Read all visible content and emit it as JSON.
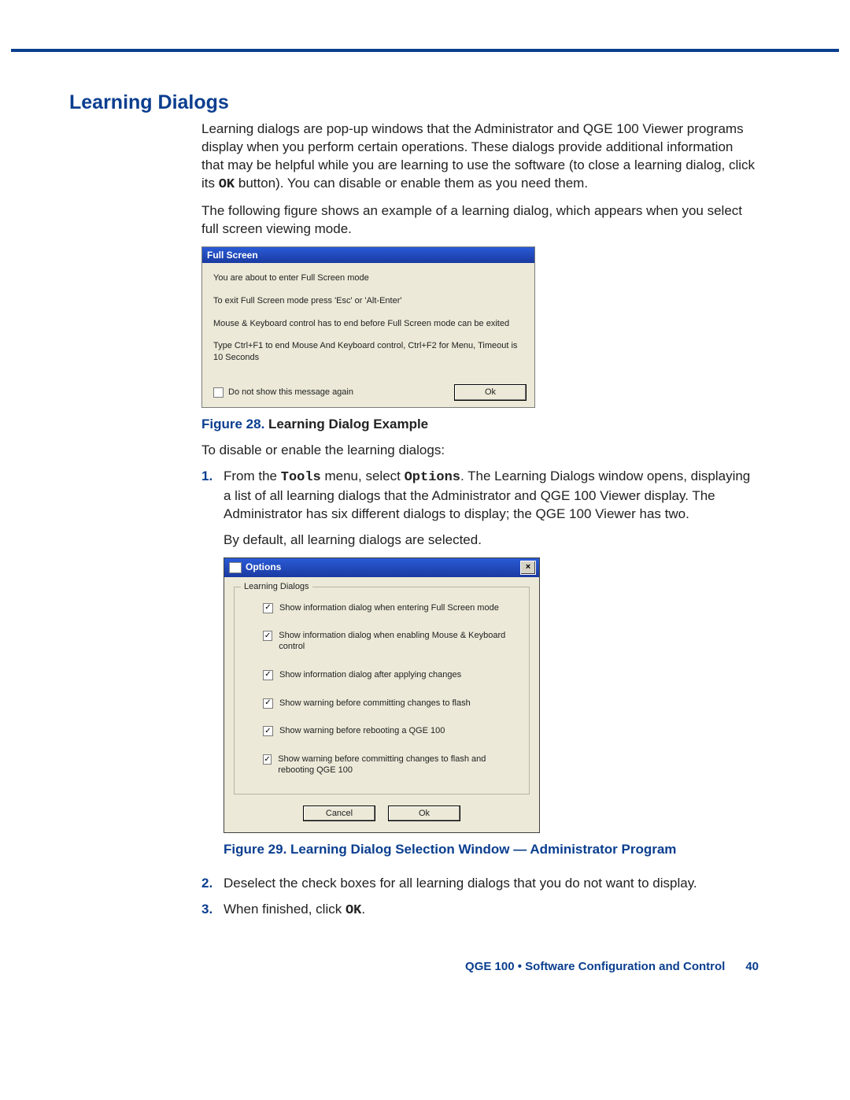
{
  "section_title": "Learning Dialogs",
  "para1_a": "Learning dialogs are pop-up windows that the Administrator and QGE 100 Viewer programs display when you perform certain operations. These dialogs provide additional information that may be helpful while you are learning to use the software (to close a learning dialog, click its ",
  "para1_b_mono": "OK",
  "para1_c": " button). You can disable or enable them as you need them.",
  "para2": "The following figure shows an example of a learning dialog, which appears when you select full screen viewing mode.",
  "dialog1": {
    "title": "Full Screen",
    "line1": "You are about to enter Full Screen mode",
    "line2": "To exit Full Screen mode press 'Esc' or 'Alt-Enter'",
    "line3": "Mouse & Keyboard control has to end before Full Screen mode can be exited",
    "line4": "Type Ctrl+F1 to end Mouse And Keyboard control, Ctrl+F2 for Menu, Timeout is 10 Seconds",
    "checkbox_label": "Do not show this message again",
    "button": "Ok"
  },
  "fig28_num": "Figure 28.",
  "fig28_text": " Learning Dialog Example",
  "para3": "To disable or enable the learning dialogs:",
  "step1": {
    "num": "1.",
    "a": "From the ",
    "tools": "Tools",
    "b": " menu, select ",
    "options": "Options",
    "c": ". The Learning Dialogs window opens, displaying a list of all learning dialogs that the Administrator and QGE 100 Viewer display. The Administrator has six different dialogs to display; the QGE 100 Viewer has two.",
    "d": "By default, all learning dialogs are selected."
  },
  "dialog2": {
    "title": "Options",
    "panel_legend": "Learning Dialogs",
    "opts": [
      "Show information dialog when entering Full Screen mode",
      "Show information dialog when enabling Mouse & Keyboard control",
      "Show information dialog after applying changes",
      "Show warning before committing changes to flash",
      "Show warning before rebooting a QGE 100",
      "Show warning before committing changes to flash and rebooting QGE 100"
    ],
    "cancel": "Cancel",
    "ok": "Ok"
  },
  "fig29_num": "Figure 29. ",
  "fig29_text": " Learning Dialog Selection Window — Administrator Program",
  "step2": {
    "num": "2.",
    "text": "Deselect the check boxes for all learning dialogs that you do not want to display."
  },
  "step3": {
    "num": "3.",
    "a": "When finished, click ",
    "ok": "OK",
    "b": "."
  },
  "footer_text": "QGE 100 • Software Configuration and Control",
  "footer_page": "40"
}
